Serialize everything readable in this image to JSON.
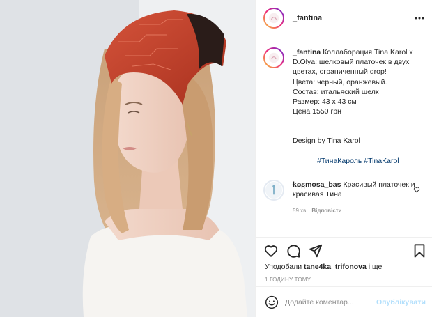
{
  "post": {
    "username": "_fantina",
    "more_icon": "more-horizontal-icon"
  },
  "caption": {
    "username": "_fantina",
    "lines": [
      "Коллаборация Tina Karol x D.Olya: шелковый платочек в двух цветах, ограниченный drop!",
      "Цвета: черный, оранжевый.",
      "Состав: итальяский шелк",
      "Размер: 43 х 43 см",
      "Цена 1550 грн",
      "",
      "",
      "Design by Tina Karol"
    ],
    "hashtags": [
      "#ТинаКароль",
      "#TinaKarol"
    ],
    "time": "1 год"
  },
  "comment": {
    "username": "kosmosa_bas",
    "text": "Красивый платочек и красивая Тина",
    "time": "59 хв",
    "reply_label": "Відповісти"
  },
  "likes": {
    "prefix": "Уподобали ",
    "user": "tane4ka_trifonova",
    "suffix": " і ще"
  },
  "post_time": "1 ГОДИНУ ТОМУ",
  "add_comment": {
    "placeholder": "Додайте коментар...",
    "publish_label": "Опублікувати"
  },
  "colors": {
    "scarf": "#c8412a",
    "link": "#00376b",
    "publish_disabled": "#b2dffc",
    "muted": "#8e8e8e"
  }
}
